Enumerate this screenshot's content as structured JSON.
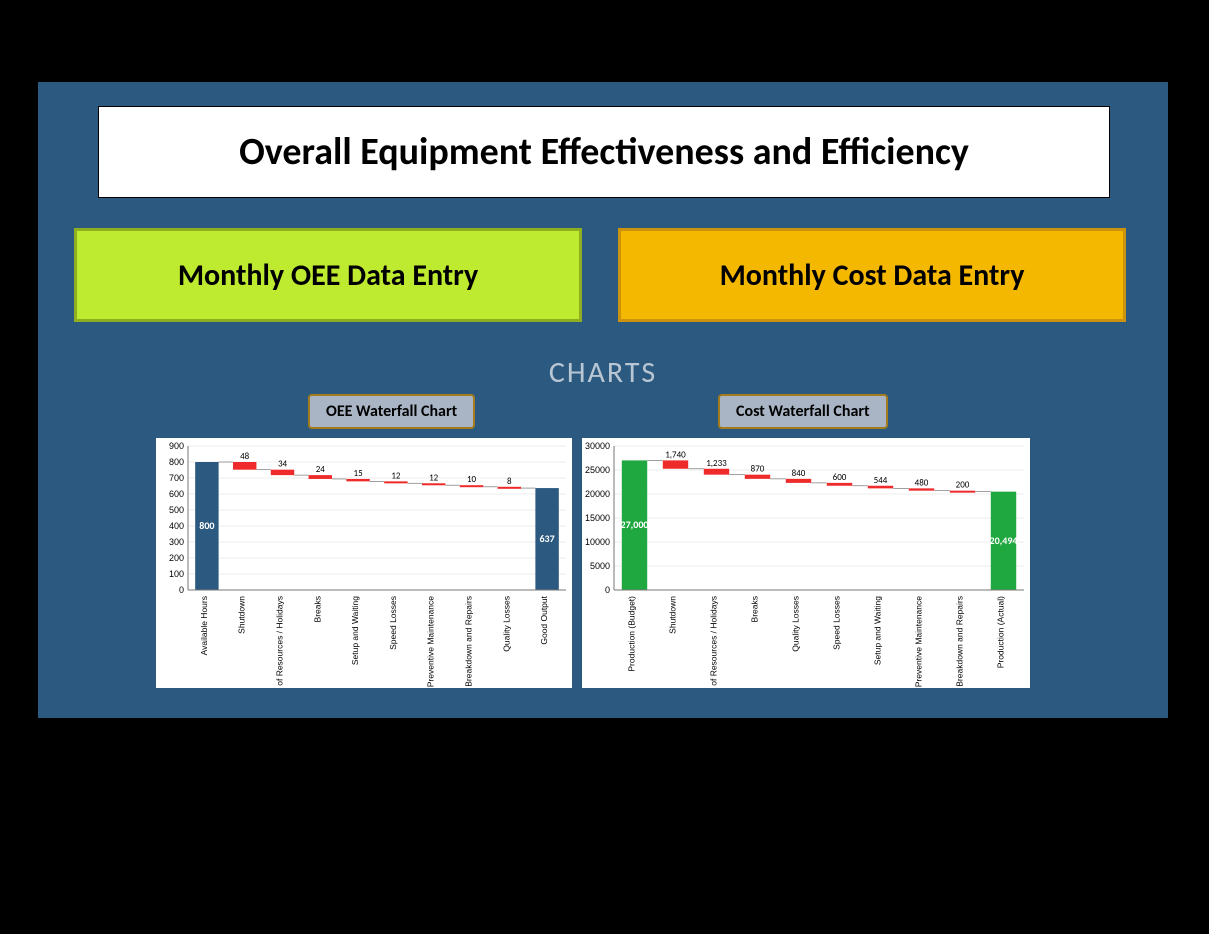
{
  "title": "Overall Equipment Effectiveness and Efficiency",
  "buttons": {
    "oee": "Monthly OEE Data Entry",
    "cost": "Monthly Cost Data Entry"
  },
  "section_header": "CHARTS",
  "chips": {
    "oee": "OEE Waterfall Chart",
    "cost": "Cost Waterfall Chart"
  },
  "chart_data": [
    {
      "id": "oee",
      "type": "bar",
      "waterfall": true,
      "categories": [
        "Available Hours",
        "Shutdown",
        "Lack of Resources / Holidays",
        "Breaks",
        "Setup and Waiting",
        "Speed Losses",
        "Preventive Maintenance",
        "Breakdown and Repairs",
        "Quality Losses",
        "Good Output"
      ],
      "values": [
        800,
        48,
        34,
        24,
        15,
        12,
        12,
        10,
        8,
        637
      ],
      "roles": [
        "total",
        "neg",
        "neg",
        "neg",
        "neg",
        "neg",
        "neg",
        "neg",
        "neg",
        "total"
      ],
      "ylim": [
        0,
        900
      ],
      "yticks": [
        0,
        100,
        200,
        300,
        400,
        500,
        600,
        700,
        800,
        900
      ],
      "colors": {
        "total": "#2b597f",
        "neg": "#ee2a2a"
      },
      "show_labels": true,
      "title": "",
      "xlabel": "",
      "ylabel": ""
    },
    {
      "id": "cost",
      "type": "bar",
      "waterfall": true,
      "categories": [
        "Production (Budget)",
        "Shutdown",
        "Lack of Resources / Holidays",
        "Breaks",
        "Quality Losses",
        "Speed Losses",
        "Setup and Waiting",
        "Preventive Maintenance",
        "Breakdown and Repairs",
        "Production (Actual)"
      ],
      "values": [
        27000,
        1740,
        1233,
        870,
        840,
        600,
        544,
        480,
        200,
        20494
      ],
      "roles": [
        "total",
        "neg",
        "neg",
        "neg",
        "neg",
        "neg",
        "neg",
        "neg",
        "neg",
        "total"
      ],
      "value_labels": [
        "27,000",
        "1,740",
        "1,233",
        "870",
        "840",
        "600",
        "544",
        "480",
        "200",
        "20,494"
      ],
      "ylim": [
        0,
        30000
      ],
      "yticks": [
        0,
        5000,
        10000,
        15000,
        20000,
        25000,
        30000
      ],
      "colors": {
        "total": "#1fa83f",
        "neg": "#ee2a2a"
      },
      "show_labels": true,
      "title": "",
      "xlabel": "",
      "ylabel": ""
    }
  ]
}
